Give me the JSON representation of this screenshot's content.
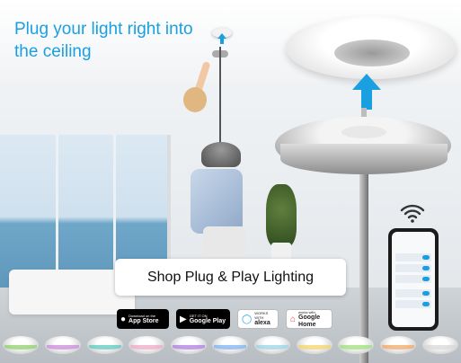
{
  "headline": "Plug your light right into the ceiling",
  "banner_label": "Shop Plug & Play Lighting",
  "badges": [
    {
      "small": "Download on the",
      "big": "App Store",
      "icon": "apple-icon"
    },
    {
      "small": "GET IT ON",
      "big": "Google Play",
      "icon": "play-icon"
    },
    {
      "small": "WORKS WITH",
      "big": "alexa",
      "icon": "alexa-icon"
    },
    {
      "small": "works with",
      "big": "Google Home",
      "icon": "google-home-icon"
    }
  ],
  "colors": {
    "accent": "#1aa0e0",
    "ring_colors": [
      "#8fd16b",
      "#c98bd9",
      "#5fc9c2",
      "#f0a9c6",
      "#b07de0",
      "#7fb3f2",
      "#9bd6e8",
      "#f5d36a",
      "#9fe07a",
      "#f2a86a",
      "#d8d8d8"
    ]
  }
}
